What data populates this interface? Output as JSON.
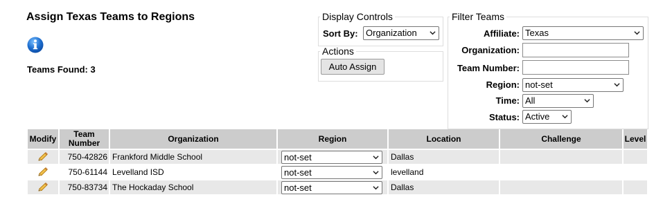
{
  "page": {
    "title": "Assign Texas Teams to Regions"
  },
  "summary": {
    "label": "Teams Found:",
    "count": "3"
  },
  "display_controls": {
    "legend": "Display Controls",
    "sort_by_label": "Sort By:",
    "sort_by_value": "Organization"
  },
  "actions": {
    "legend": "Actions",
    "auto_assign_label": "Auto Assign"
  },
  "filter": {
    "legend": "Filter Teams",
    "affiliate_label": "Affiliate:",
    "affiliate_value": "Texas",
    "organization_label": "Organization:",
    "organization_value": "",
    "team_number_label": "Team Number:",
    "team_number_value": "",
    "region_label": "Region:",
    "region_value": "not-set",
    "time_label": "Time:",
    "time_value": "All",
    "status_label": "Status:",
    "status_value": "Active"
  },
  "table": {
    "headers": {
      "modify": "Modify",
      "team_number_line1": "Team",
      "team_number_line2": "Number",
      "organization": "Organization",
      "region": "Region",
      "location": "Location",
      "challenge": "Challenge",
      "level": "Level"
    },
    "rows": [
      {
        "team_number": "750-42826",
        "organization": "Frankford Middle School",
        "region": "not-set",
        "location": "Dallas",
        "challenge": "",
        "level": ""
      },
      {
        "team_number": "750-61144",
        "organization": "Levelland ISD",
        "region": "not-set",
        "location": "levelland",
        "challenge": "",
        "level": ""
      },
      {
        "team_number": "750-83734",
        "organization": "The Hockaday School",
        "region": "not-set",
        "location": "Dallas",
        "challenge": "",
        "level": ""
      }
    ]
  },
  "colors": {
    "header_bg": "#cccccc",
    "row_alt_bg": "#e8e8e8",
    "info_icon": "#1e6fd0",
    "pencil": "#e8a21b"
  }
}
